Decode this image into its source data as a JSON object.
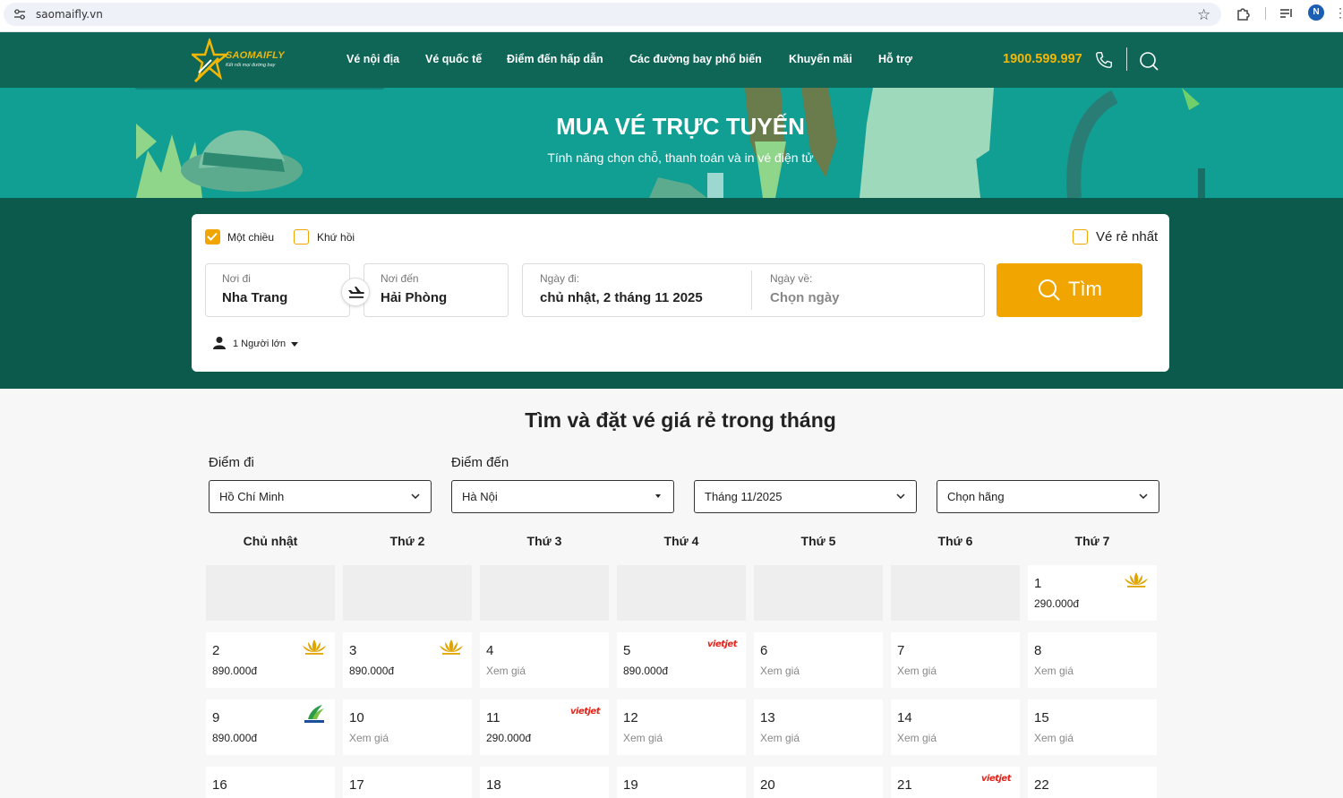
{
  "browser": {
    "url": "saomaifly.vn",
    "profile_initial": "N"
  },
  "header": {
    "logo_name": "SAOMAIFLY",
    "logo_tagline": "Kết nối mọi đường bay",
    "nav": [
      "Vé nội địa",
      "Vé quốc tế",
      "Điểm đến hấp dẫn",
      "Các đường bay phổ biến",
      "Khuyến mãi",
      "Hỗ trợ"
    ],
    "hotline": "1900.599.997"
  },
  "hero": {
    "title": "MUA VÉ TRỰC TUYẾN",
    "subtitle": "Tính năng chọn chỗ, thanh toán và in vé điện tử"
  },
  "search_form": {
    "one_way": "Một chiều",
    "round_trip": "Khứ hồi",
    "cheapest": "Vé rẻ nhất",
    "from_label": "Nơi đi",
    "from_value": "Nha Trang",
    "to_label": "Nơi đến",
    "to_value": "Hải Phòng",
    "depart_label": "Ngày đi:",
    "depart_value": "chủ nhật, 2 tháng 11 2025",
    "return_label": "Ngày về:",
    "return_placeholder": "Chọn ngày",
    "search_button": "Tìm",
    "passengers": "1 Người lớn"
  },
  "monthly": {
    "title": "Tìm và đặt vé giá rẻ trong tháng",
    "from_label": "Điểm đi",
    "to_label": "Điểm đến",
    "from_value": "Hồ Chí Minh",
    "to_value": "Hà Nội",
    "month_value": "Tháng 11/2025",
    "airline_value": "Chọn hãng",
    "weekdays": [
      "Chủ nhật",
      "Thứ 2",
      "Thứ 3",
      "Thứ 4",
      "Thứ 5",
      "Thứ 6",
      "Thứ 7"
    ],
    "days": [
      {
        "day": "1",
        "price": "290.000đ",
        "airline": "vietnam-airlines"
      },
      {
        "day": "2",
        "price": "890.000đ",
        "airline": "vietnam-airlines"
      },
      {
        "day": "3",
        "price": "890.000đ",
        "airline": "vietnam-airlines"
      },
      {
        "day": "4",
        "price": "Xem giá",
        "airline": ""
      },
      {
        "day": "5",
        "price": "890.000đ",
        "airline": "vietjet"
      },
      {
        "day": "6",
        "price": "Xem giá",
        "airline": ""
      },
      {
        "day": "7",
        "price": "Xem giá",
        "airline": ""
      },
      {
        "day": "8",
        "price": "Xem giá",
        "airline": ""
      },
      {
        "day": "9",
        "price": "890.000đ",
        "airline": "bamboo"
      },
      {
        "day": "10",
        "price": "Xem giá",
        "airline": ""
      },
      {
        "day": "11",
        "price": "290.000đ",
        "airline": "vietjet"
      },
      {
        "day": "12",
        "price": "Xem giá",
        "airline": ""
      },
      {
        "day": "13",
        "price": "Xem giá",
        "airline": ""
      },
      {
        "day": "14",
        "price": "Xem giá",
        "airline": ""
      },
      {
        "day": "15",
        "price": "Xem giá",
        "airline": ""
      },
      {
        "day": "16",
        "price": "",
        "airline": ""
      },
      {
        "day": "17",
        "price": "",
        "airline": ""
      },
      {
        "day": "18",
        "price": "",
        "airline": ""
      },
      {
        "day": "19",
        "price": "",
        "airline": ""
      },
      {
        "day": "20",
        "price": "",
        "airline": ""
      },
      {
        "day": "21",
        "price": "",
        "airline": "vietjet"
      },
      {
        "day": "22",
        "price": "",
        "airline": ""
      }
    ],
    "vietjet_text": "vietjet",
    "bamboo_text": "BAMBOO"
  },
  "colors": {
    "header": "#0f6656",
    "hero": "#119e93",
    "band": "#0b5a4b",
    "accent": "#f0a500",
    "vietjet": "#e2231a"
  }
}
